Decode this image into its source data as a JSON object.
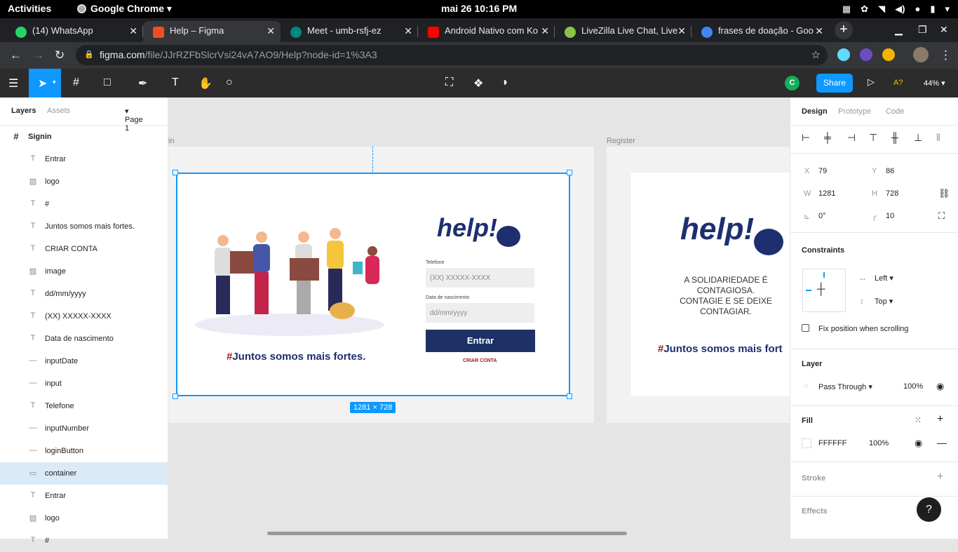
{
  "system_bar": {
    "activities": "Activities",
    "app": "Google Chrome",
    "clock": "mai 26  10:16 PM"
  },
  "browser": {
    "tabs": [
      {
        "label": "(14) WhatsApp",
        "color": "#25d366"
      },
      {
        "label": "Help – Figma",
        "color": "#f24e1e"
      },
      {
        "label": "Meet - umb-rsfj-ez",
        "color": "#00897b"
      },
      {
        "label": "Android Nativo com Ko",
        "color": "#ff0000"
      },
      {
        "label": "LiveZilla Live Chat, Live",
        "color": "#8bc34a"
      },
      {
        "label": "frases de doação - Goo",
        "color": "#4285f4"
      }
    ],
    "url_host": "figma.com",
    "url_path": "/file/JJrRZFbSlcrVsi24vA7AO9/Help?node-id=1%3A3"
  },
  "figma_toolbar": {
    "user_initial": "C",
    "share_label": "Share",
    "font_check": "A?",
    "zoom": "44%"
  },
  "layers_panel": {
    "tab_layers": "Layers",
    "tab_assets": "Assets",
    "page": "Page 1",
    "frame_name": "Signin",
    "items": [
      {
        "icon": "text",
        "label": "Entrar"
      },
      {
        "icon": "image",
        "label": "logo"
      },
      {
        "icon": "text",
        "label": "#"
      },
      {
        "icon": "text",
        "label": "Juntos somos mais fortes."
      },
      {
        "icon": "text",
        "label": "CRIAR CONTA"
      },
      {
        "icon": "image",
        "label": "image"
      },
      {
        "icon": "text",
        "label": "dd/mm/yyyy"
      },
      {
        "icon": "text",
        "label": "(XX) XXXXX-XXXX"
      },
      {
        "icon": "text",
        "label": "Data de nascimento"
      },
      {
        "icon": "line",
        "label": "inputDate"
      },
      {
        "icon": "line",
        "label": "input"
      },
      {
        "icon": "text",
        "label": "Telefone"
      },
      {
        "icon": "line",
        "label": "inputNumber"
      },
      {
        "icon": "line",
        "label": "loginButton"
      },
      {
        "icon": "rect",
        "label": "container",
        "selected": true
      },
      {
        "icon": "text",
        "label": "Entrar"
      },
      {
        "icon": "image",
        "label": "logo"
      },
      {
        "icon": "text",
        "label": "#"
      }
    ]
  },
  "canvas": {
    "frame1_label": "in",
    "frame2_label": "Register",
    "size_badge": "1281 × 728",
    "signin": {
      "logo": "help!",
      "telefone_label": "Telefone",
      "telefone_placeholder": "(XX) XXXXX-XXXX",
      "date_label": "Data de nascimento",
      "date_placeholder": "dd/mm/yyyy",
      "button": "Entrar",
      "create_account": "CRIAR CONTA",
      "hash": "#",
      "slogan": "Juntos somos mais fortes."
    },
    "register": {
      "logo": "help!",
      "line1": "A SOLIDARIEDADE É",
      "line2": "CONTAGIOSA.",
      "line3": "CONTAGIE E SE DEIXE",
      "line4": "CONTAGIAR.",
      "hash": "#",
      "slogan": "Juntos somos mais fort"
    }
  },
  "design_panel": {
    "tabs": [
      "Design",
      "Prototype",
      "Code"
    ],
    "x_label": "X",
    "x": "79",
    "y_label": "Y",
    "y": "86",
    "w_label": "W",
    "w": "1281",
    "h_label": "H",
    "h": "728",
    "rotation": "0°",
    "radius": "10",
    "constraints_title": "Constraints",
    "h_constraint": "Left",
    "v_constraint": "Top",
    "fix_position": "Fix position when scrolling",
    "layer_title": "Layer",
    "blend": "Pass Through",
    "opacity": "100%",
    "fill_title": "Fill",
    "fill_hex": "FFFFFF",
    "fill_opacity": "100%",
    "stroke_title": "Stroke",
    "effects_title": "Effects",
    "help": "?"
  }
}
